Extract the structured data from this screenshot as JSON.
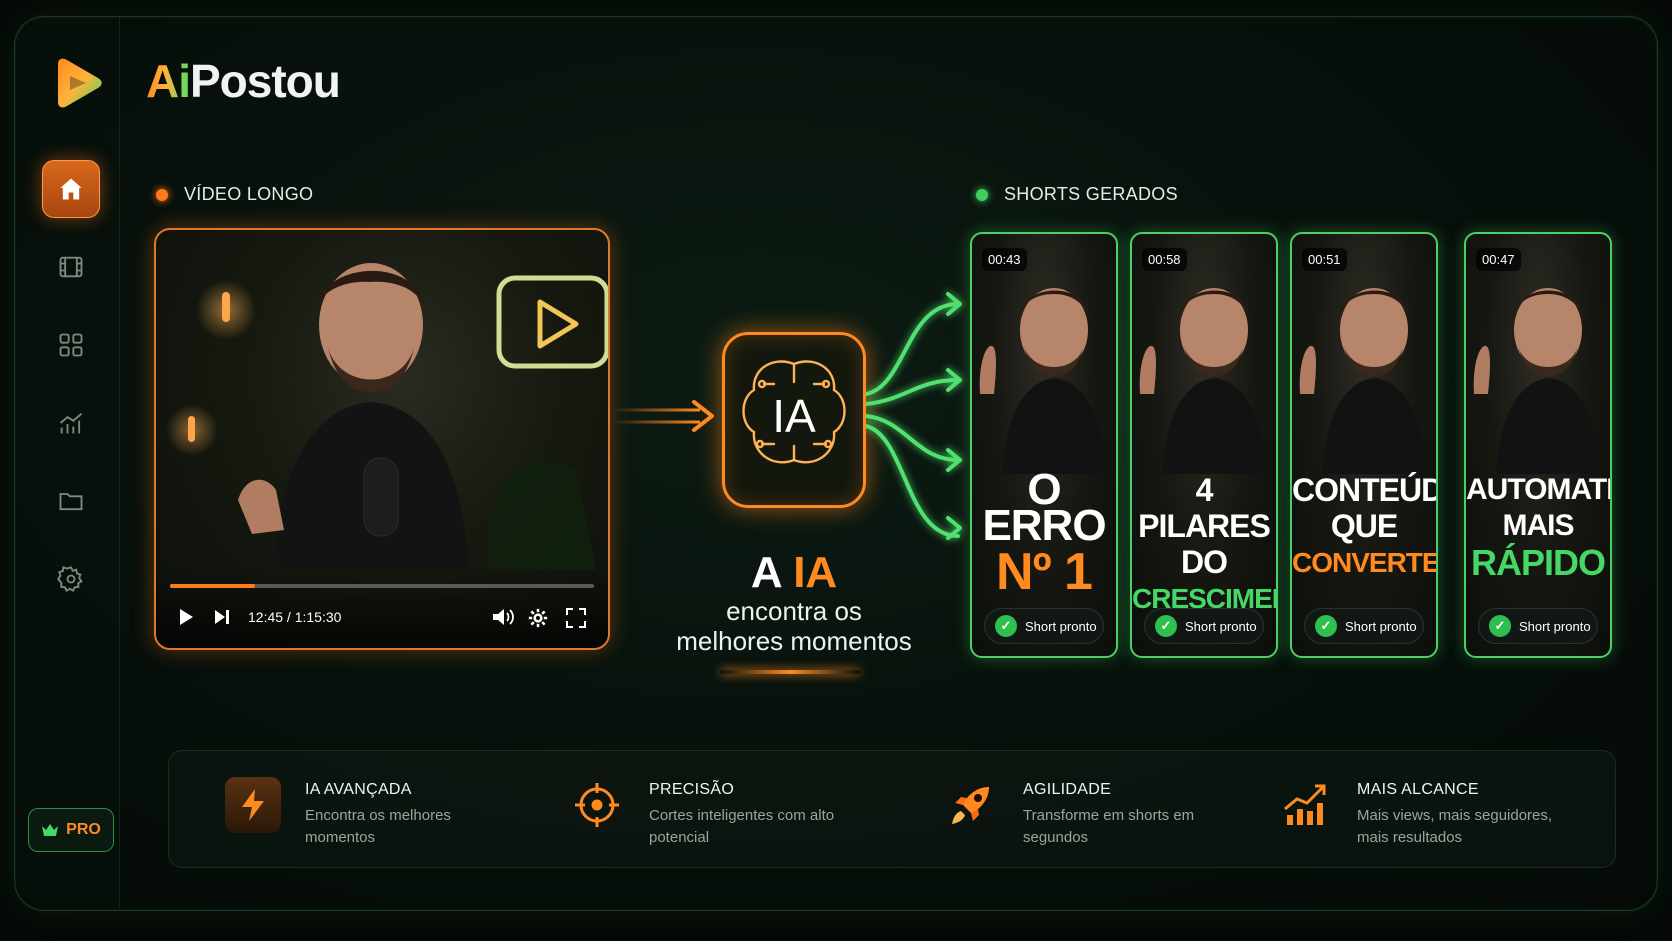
{
  "brand": {
    "ai": "Ai",
    "name": "Postou"
  },
  "sidebar": {
    "items": [
      {
        "icon": "home-icon",
        "active": true
      },
      {
        "icon": "film-icon"
      },
      {
        "icon": "grid-icon"
      },
      {
        "icon": "chart-icon"
      },
      {
        "icon": "folder-icon"
      },
      {
        "icon": "gear-icon"
      }
    ],
    "pro_label": "PRO"
  },
  "long_video": {
    "label": "VÍDEO LONGO",
    "time": "12:45 / 1:15:30",
    "progress": 0.2
  },
  "ai_center": {
    "box_text": "IA",
    "tagline_a": "A ",
    "tagline_b": "IA",
    "sub1": "encontra os",
    "sub2": "melhores momentos"
  },
  "shorts": {
    "label": "SHORTS GERADOS",
    "items": [
      {
        "time": "00:43",
        "line1": "O ERRO",
        "line2": "",
        "highlight": "Nº 1",
        "color": "#ff8a1f",
        "status": "Short pronto"
      },
      {
        "time": "00:58",
        "line1": "4 PILARES",
        "line2": "DO",
        "highlight": "CRESCIMENTO",
        "color": "#46d866",
        "status": "Short pronto"
      },
      {
        "time": "00:51",
        "line1": "CONTEÚDO",
        "line2": "QUE",
        "highlight": "CONVERTE",
        "color": "#ff8a1f",
        "status": "Short pronto"
      },
      {
        "time": "00:47",
        "line1": "AUTOMATIZE",
        "line2": "MAIS",
        "highlight": "RÁPIDO",
        "color": "#46d866",
        "status": "Short pronto"
      }
    ]
  },
  "features": [
    {
      "icon": "bolt-icon",
      "title": "IA AVANÇADA",
      "desc": "Encontra os melhores momentos"
    },
    {
      "icon": "target-icon",
      "title": "PRECISÃO",
      "desc": "Cortes inteligentes com alto potencial"
    },
    {
      "icon": "rocket-icon",
      "title": "AGILIDADE",
      "desc": "Transforme em shorts em segundos"
    },
    {
      "icon": "growth-chart-icon",
      "title": "MAIS ALCANCE",
      "desc": "Mais views, mais seguidores, mais resultados"
    }
  ],
  "colors": {
    "accent_orange": "#ff8a1f",
    "accent_green": "#46d866",
    "background": "#07100b"
  }
}
